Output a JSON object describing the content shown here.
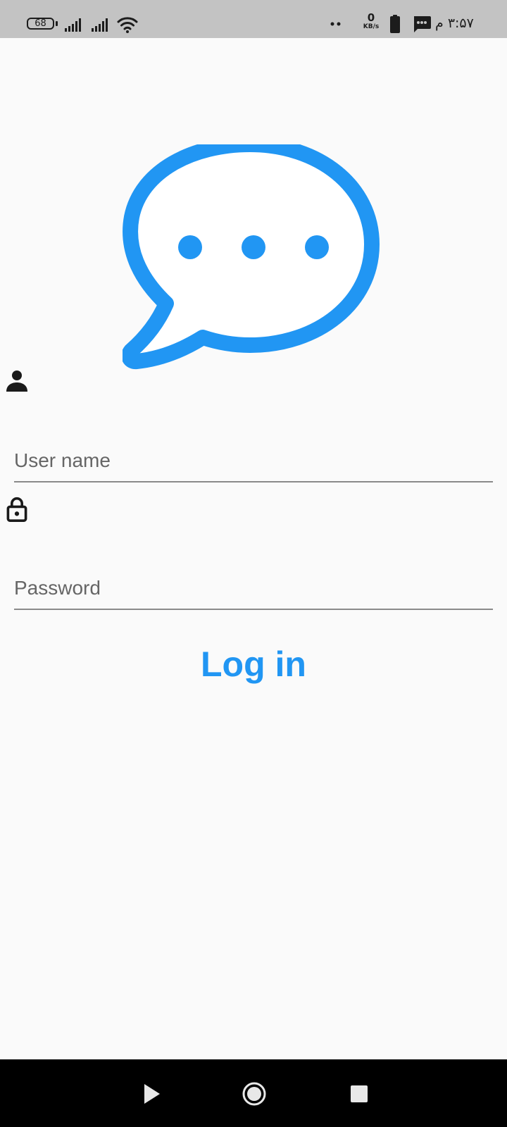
{
  "status_bar": {
    "battery_level": "68",
    "net_speed_value": "0",
    "net_speed_unit": "KB/s",
    "time": "۳:۵۷ م",
    "icons": [
      "battery-icon",
      "signal-icon",
      "signal-icon",
      "wifi-icon",
      "dots-icon",
      "battery-charge-icon",
      "message-icon"
    ]
  },
  "logo": {
    "icon": "chat-bubble-icon",
    "color": "#2196f3"
  },
  "form": {
    "username_icon": "person-icon",
    "username_placeholder": "User name",
    "username_value": "",
    "password_icon": "lock-icon",
    "password_placeholder": "Password",
    "password_value": "",
    "login_label": "Log in"
  },
  "nav_bar": {
    "buttons": [
      "back-icon",
      "home-icon",
      "recents-icon"
    ]
  },
  "colors": {
    "accent": "#2196f3",
    "background": "#fafafa",
    "status_bar": "#c3c3c3",
    "nav_bar": "#000000"
  }
}
